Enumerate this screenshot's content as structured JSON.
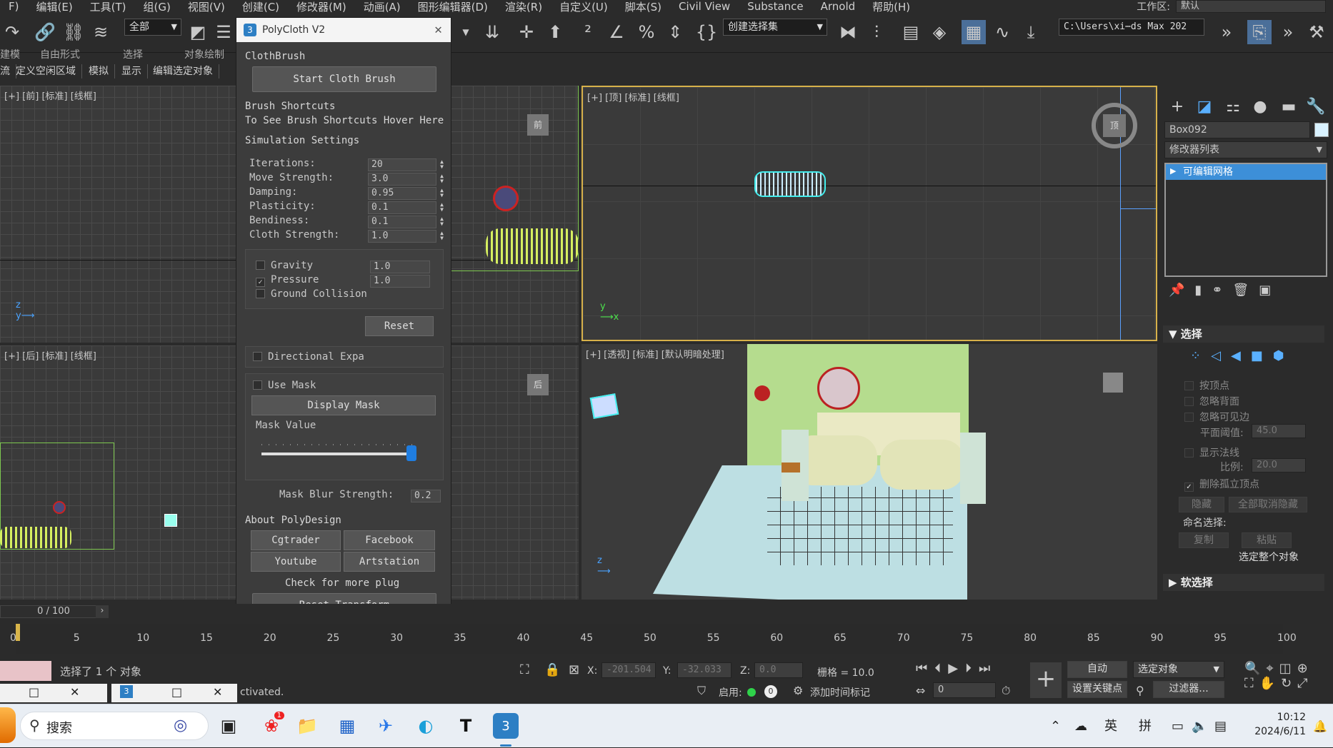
{
  "menubar": {
    "items": [
      "F)",
      "编辑(E)",
      "工具(T)",
      "组(G)",
      "视图(V)",
      "创建(C)",
      "修改器(M)",
      "动画(A)",
      "图形编辑器(D)",
      "渲染(R)",
      "自定义(U)",
      "脚本(S)",
      "Civil View",
      "Substance",
      "Arnold",
      "帮助(H)"
    ],
    "workspace_label": "工作区:",
    "workspace_value": "默认"
  },
  "toolbar": {
    "selection_filter": "全部",
    "named_selection": "创建选择集",
    "project_path": "C:\\Users\\xi⋯ds Max 202"
  },
  "ribbon": {
    "row1": [
      "建模",
      "自由形式",
      "选择",
      "对象绘制"
    ],
    "row2": [
      "流",
      "定义空闲区域",
      "模拟",
      "显示",
      "编辑选定对象"
    ]
  },
  "viewports": {
    "front": "[+] [前] [标准] [线框]",
    "top": "[+] [顶] [标准] [线框]",
    "back": "[+] [后] [标准] [线框]",
    "perspective": "[+] [透视] [标准] [默认明暗处理]",
    "cube_top": "顶",
    "cube_front": "前",
    "cube_back": "后"
  },
  "polycloth": {
    "title": "PolyCloth V2",
    "clothbrush_label": "ClothBrush",
    "start_button": "Start Cloth Brush",
    "shortcuts_title": "Brush Shortcuts",
    "shortcuts_hint": "To See Brush Shortcuts Hover Here",
    "sim_title": "Simulation Settings",
    "params": [
      {
        "label": "Iterations:",
        "value": "20"
      },
      {
        "label": "Move Strength:",
        "value": "3.0"
      },
      {
        "label": "Damping:",
        "value": "0.95"
      },
      {
        "label": "Plasticity:",
        "value": "0.1"
      },
      {
        "label": "Bendiness:",
        "value": "0.1"
      },
      {
        "label": "Cloth Strength:",
        "value": "1.0"
      }
    ],
    "gravity": {
      "label": "Gravity",
      "value": "1.0",
      "checked": false
    },
    "pressure": {
      "label": "Pressure",
      "value": "1.0",
      "checked": true
    },
    "ground": {
      "label": "Ground Collision",
      "checked": false
    },
    "reset_button": "Reset",
    "directional": "Directional Expa",
    "use_mask": "Use Mask",
    "display_mask": "Display Mask",
    "mask_value_label": "Mask Value",
    "mask_value": 0.97,
    "mask_blur_label": "Mask Blur Strength:",
    "mask_blur_value": "0.2",
    "about_title": "About PolyDesign",
    "links": [
      "Cgtrader",
      "Facebook",
      "Youtube",
      "Artstation"
    ],
    "more_plug": "Check for more plug",
    "reset_transform": "Reset Transform"
  },
  "command_panel": {
    "object_name": "Box092",
    "modifier_list": "修改器列表",
    "stack_item": "可编辑网格",
    "selection_title": "选择",
    "opts": [
      "按顶点",
      "忽略背面",
      "忽略可见边"
    ],
    "planar_label": "平面阈值:",
    "planar_value": "45.0",
    "show_normals": "显示法线",
    "scale_label": "比例:",
    "scale_value": "20.0",
    "delete_isolated": "删除孤立顶点",
    "hide": "隐藏",
    "unhide_all": "全部取消隐藏",
    "named_sel": "命名选择:",
    "copy": "复制",
    "paste": "粘贴",
    "select_whole": "选定整个对象",
    "soft_sel": "软选择"
  },
  "timeline": {
    "frame_display": "0 / 100",
    "ticks": [
      "0",
      "5",
      "10",
      "15",
      "20",
      "25",
      "30",
      "35",
      "40",
      "45",
      "50",
      "55",
      "60",
      "65",
      "70",
      "75",
      "80",
      "85",
      "90",
      "95",
      "100"
    ]
  },
  "status": {
    "selected": "选择了 1 个 对象",
    "activated": "ctivated.",
    "x_label": "X:",
    "x_value": "-201.504",
    "y_label": "Y:",
    "y_value": "-32.033",
    "z_label": "Z:",
    "z_value": "0.0",
    "grid": "栅格 = 10.0",
    "enable": "启用:",
    "add_time_tag": "添加时间标记",
    "auto": "自动",
    "set_key": "设置关键点",
    "selected_obj": "选定对象",
    "filter": "过滤器...",
    "frame_field": "0"
  },
  "taskbar": {
    "search": "搜索",
    "lang1": "英",
    "lang2": "拼",
    "time": "10:12",
    "date": "2024/6/11",
    "badge": "1"
  }
}
